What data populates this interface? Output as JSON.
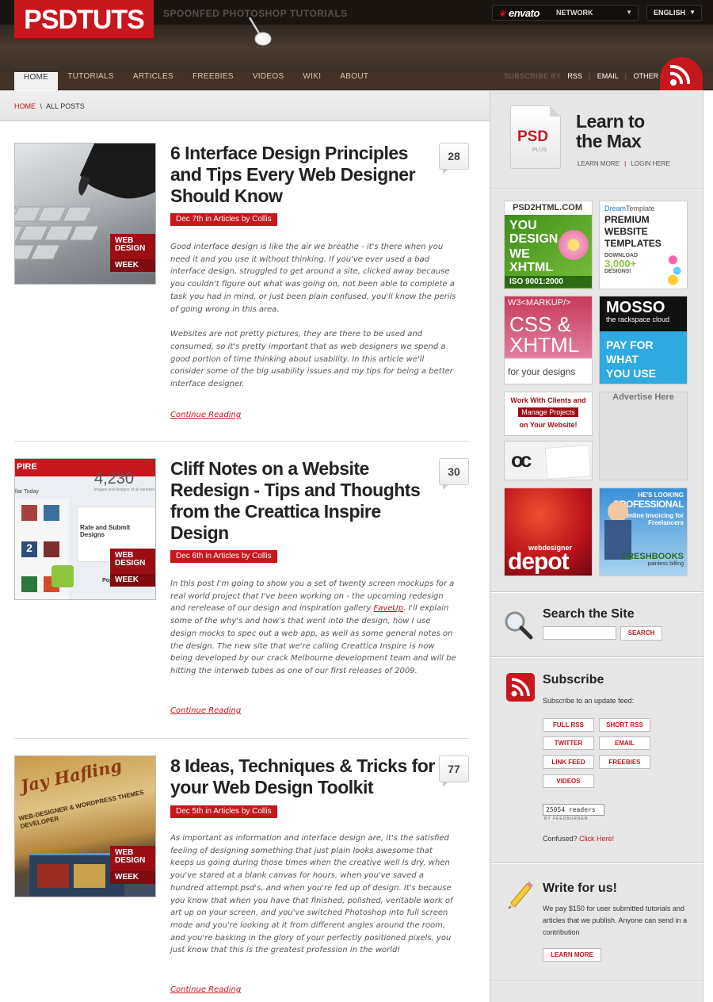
{
  "header": {
    "logo": "PSDTUTS",
    "tagline": "SPOONFED PHOTOSHOP TUTORIALS",
    "network_brand": "envato",
    "network_label": "NETWORK",
    "language": "ENGLISH"
  },
  "nav": {
    "items": [
      "HOME",
      "TUTORIALS",
      "ARTICLES",
      "FREEBIES",
      "VIDEOS",
      "WIKI",
      "ABOUT"
    ],
    "active": "HOME",
    "subscribe_label": "SUBSCRIBE BY",
    "subscribe_links": [
      "RSS",
      "EMAIL",
      "OTHER"
    ]
  },
  "breadcrumb": {
    "home": "HOME",
    "sep": "\\",
    "current": "ALL POSTS"
  },
  "posts": [
    {
      "title": "6 Interface Design Principles and Tips Every Web Designer Should Know",
      "meta": "Dec 7th in Articles by Collis",
      "comments": "28",
      "badge": [
        "WEB",
        "DESIGN",
        "WEEK"
      ],
      "paragraphs": [
        "Good interface design is like the air we breathe - it's there when you need it and you use it without thinking. If you've ever used a bad interface design, struggled to get around a site, clicked away because you couldn't figure out what was going on, not been able to complete a task you had in mind, or just been plain confused, you'll know the perils of going wrong in this area.",
        "Websites are not pretty pictures, they are there to be used and consumed, so it's pretty important that as web designers we spend a good portion of time thinking about usability. In this article we'll consider some of the big usability issues and my tips for being a better interface designer."
      ],
      "continue": "Continue Reading"
    },
    {
      "title": "Cliff Notes on a Website Redesign - Tips and Thoughts from the Creattica Inspire Design",
      "meta": "Dec 6th in Articles by Collis",
      "comments": "30",
      "badge": [
        "WEB",
        "DESIGN",
        "WEEK"
      ],
      "thumb_text": {
        "brand": "PIRE",
        "count": "4,230",
        "sub": "images and designs of all varieties",
        "today": "llar Today",
        "rate": "Rate and Submit Designs",
        "pop": "Popu",
        "num": "2"
      },
      "paragraphs_before": "In this post I'm going to show you a set of twenty screen mockups for a real world project that I've been working on - the upcoming redesign and rerelease of our design and inspiration gallery",
      "inline_link": "FaveUp",
      "paragraphs_after": ". I'll explain some of the why's and how's that went into the design, how I use design mocks to spec out a web app, as well as some general notes on the design. The new site that we're calling Creattica Inspire is now being developed by our crack Melbourne development team and will be hitting the interweb tubes as one of our first releases of 2009.",
      "continue": "Continue Reading"
    },
    {
      "title": "8 Ideas, Techniques & Tricks for your Web Design Toolkit",
      "meta": "Dec 5th in Articles by Collis",
      "comments": "77",
      "badge": [
        "WEB",
        "DESIGN",
        "WEEK"
      ],
      "thumb_text": {
        "script": "Jay Hafling",
        "sub": "WEB-DESIGNER & WORDPRESS THEMES DEVELOPER"
      },
      "paragraphs": [
        "As important as information and interface design are, it's the satisfied feeling of designing something that just plain looks awesome that keeps us going during those times when the creative well is dry, when you've stared at a blank canvas for hours, when you've saved a hundred attempt.psd's, and when you're fed up of design. It's because you know that when you have that finished, polished, veritable work of art up on your screen, and you've switched Photoshop into full screen mode and you're looking at it from different angles around the room, and you're basking in the glory of your perfectly positioned pixels, you just know that this is the greatest profession in the world!"
      ],
      "continue": "Continue Reading"
    }
  ],
  "sidebar": {
    "psdplus": {
      "file_text": "PSD",
      "file_sub": "PLUS",
      "heading": "Learn to the Max",
      "learn_more": "LEARN MORE",
      "login_here": "LOGIN HERE"
    },
    "ads": {
      "psd2html": {
        "top": "PSD2HTML.COM",
        "l1": "YOU",
        "l2": "DESIGN",
        "l3": "WE",
        "l4": "XHTML",
        "l5": "ISO 9001:2000"
      },
      "dreamtemplate": {
        "brand1": "Dream",
        "brand2": "Template",
        "l1": "PREMIUM",
        "l2": "WEBSITE",
        "l3": "TEMPLATES",
        "l4": "DOWNLOAD",
        "l5": "3,000+",
        "l6": "DESIGNS!"
      },
      "w3markup": {
        "top": "W3<MARKUP/>",
        "l1": "CSS &",
        "l2": "XHTML",
        "l3": "for your designs"
      },
      "mosso": {
        "l1": "MOSSO",
        "l2": "the rackspace cloud",
        "l3": "PAY FOR",
        "l4": "WHAT",
        "l5": "YOU USE"
      },
      "clients": {
        "l1": "Work With Clients and",
        "l2": "Manage Projects",
        "l3": "on Your Website!"
      },
      "advertise": "Advertise Here",
      "oc": "oc",
      "wddepot": {
        "l1": "webdesigner",
        "l2": "depot"
      },
      "freshbooks": {
        "l1": "HE'S LOOKING",
        "l2": "PROFESSIONAL",
        "l3": "Online Invoicing for",
        "l4": "Freelancers",
        "l5": "FRESHBOOKS",
        "l6": "painless billing"
      }
    },
    "search": {
      "heading": "Search the Site",
      "button": "SEARCH",
      "placeholder": ""
    },
    "subscribe": {
      "heading": "Subscribe",
      "intro": "Subscribe to an update feed:",
      "buttons": [
        "FULL RSS",
        "SHORT RSS",
        "TWITTER",
        "EMAIL",
        "LINK FEED",
        "FREEBIES",
        "VIDEOS"
      ],
      "readers_count": "25054",
      "readers_label": "readers",
      "feedburner": "BY FEEDBURNER",
      "confused": "Confused?",
      "click_here": "Click Here!"
    },
    "write": {
      "heading": "Write for us!",
      "text": "We pay $150 for user submitted tutorials and articles that we publish. Anyone can send in a contribution",
      "button": "LEARN MORE"
    }
  },
  "colors": {
    "brand_red": "#c8161d",
    "header_brown": "#3b3027",
    "sidebar_gray": "#e6e6e6"
  }
}
